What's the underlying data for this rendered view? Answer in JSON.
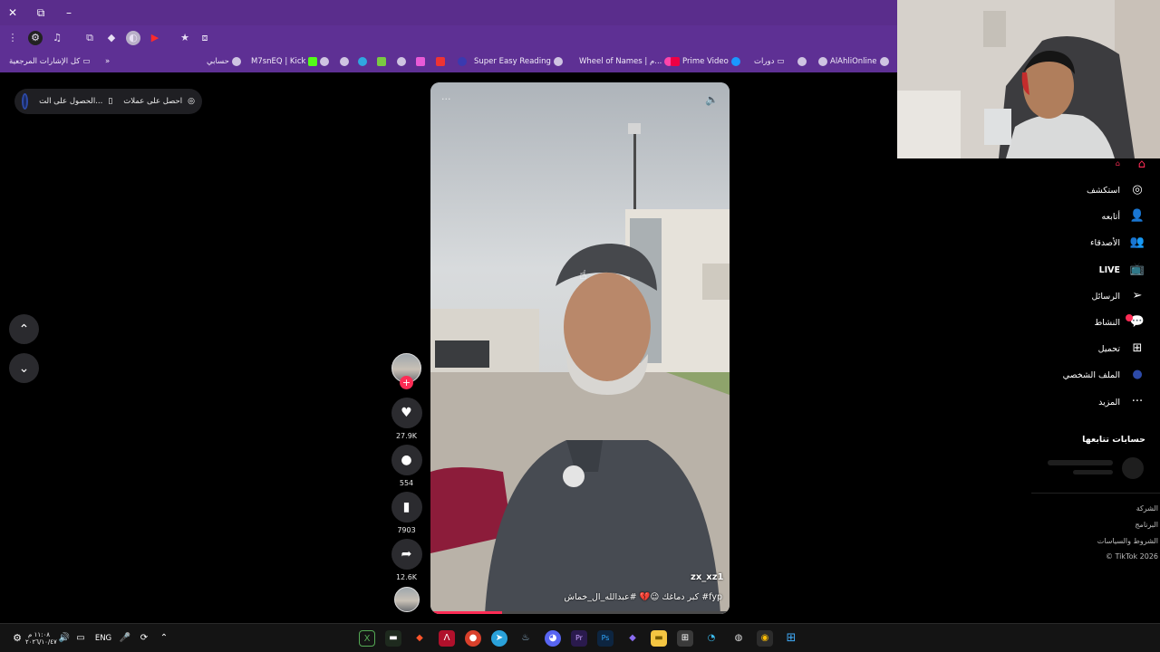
{
  "browser": {
    "window_buttons": [
      "✕",
      "⧉",
      "–"
    ],
    "bookmarks": [
      {
        "label": "AlAhliOnline"
      },
      {
        "label": "دورات"
      },
      {
        "label": "Prime Video"
      },
      {
        "label": "Wheel of Names | م..."
      },
      {
        "label": "Super Easy Reading"
      },
      {
        "label": "M7snEQ | Kick"
      },
      {
        "label": "حسابي"
      }
    ],
    "bookmarks_folder": "كل الإشارات المرجعية"
  },
  "promo": {
    "get_coins": "احصل على عملات",
    "get_app": "الحصول على الت..."
  },
  "video": {
    "author": "zx_xz1",
    "caption": "كبر دماغك 😉💔 #عبدالله_ال_خماش #fyp",
    "progress": 0.24
  },
  "actions": {
    "likes": "27.9K",
    "comments": "554",
    "saves": "7903",
    "shares": "12.6K"
  },
  "sidebar": {
    "items": [
      {
        "label": "استكشف",
        "icon": "compass-icon",
        "glyph": "◎"
      },
      {
        "label": "أتابعه",
        "icon": "user-follow-icon",
        "glyph": "👤"
      },
      {
        "label": "الأصدقاء",
        "icon": "friends-icon",
        "glyph": "👥"
      },
      {
        "label": "LIVE",
        "icon": "live-tv-icon",
        "glyph": "📺"
      },
      {
        "label": "الرسائل",
        "icon": "send-icon",
        "glyph": "➢"
      },
      {
        "label": "النشاط",
        "icon": "activity-icon",
        "glyph": "💬"
      },
      {
        "label": "تحميل",
        "icon": "upload-plus-icon",
        "glyph": "⊞"
      },
      {
        "label": "الملف الشخصي",
        "icon": "profile-avatar-icon",
        "glyph": "●"
      },
      {
        "label": "المزيد",
        "icon": "more-icon",
        "glyph": "···"
      }
    ],
    "following_title": "حسابات تتابعها",
    "footer": [
      "الشركة",
      "البرنامج",
      "الشروط والسياسات",
      "© TikTok 2026"
    ]
  },
  "taskbar": {
    "time": "١١:٠٨ م",
    "date": "٢٠٢٦/١٠/٤٧",
    "language": "ENG"
  },
  "colors": {
    "accent": "#fe2c55",
    "chrome": "#5e3094"
  }
}
